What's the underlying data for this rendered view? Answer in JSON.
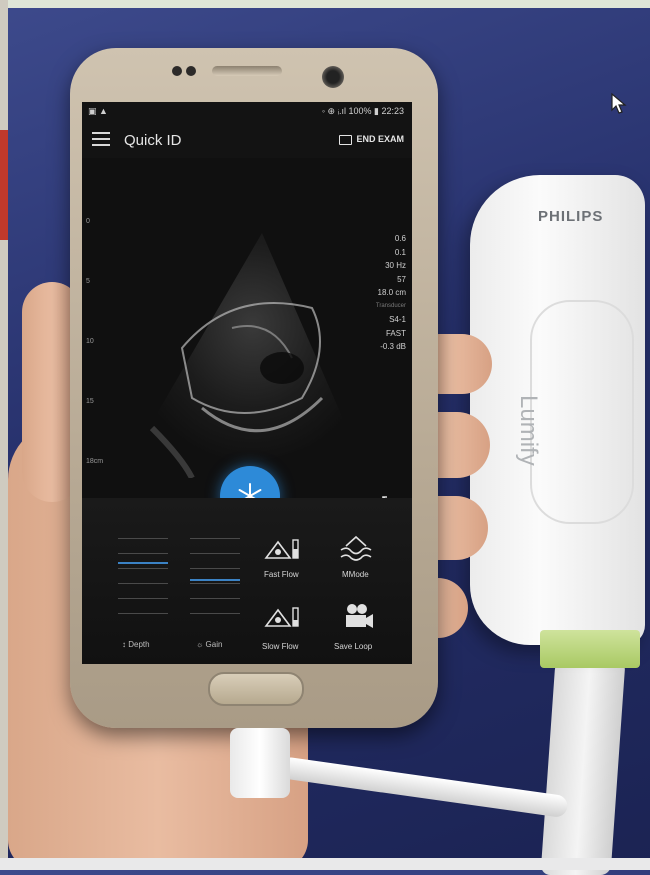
{
  "status_bar": {
    "left": "▣ ▲",
    "right": "◦ ⊕ ᵢ.ıl 100% ▮ 22:23"
  },
  "app_bar": {
    "title": "Quick ID",
    "end_exam_label": "END EXAM",
    "menu_icon": "hamburger-menu-icon"
  },
  "depth_scale": {
    "ticks": [
      "0",
      "5",
      "10",
      "15",
      "18cm"
    ]
  },
  "params": [
    {
      "label": "",
      "value": "0.6"
    },
    {
      "label": "",
      "value": "0.1"
    },
    {
      "label": "",
      "value": "30 Hz"
    },
    {
      "label": "",
      "value": "57"
    },
    {
      "label": "",
      "value": "18.0 cm"
    },
    {
      "label": "Transducer",
      "value": "S4-1"
    },
    {
      "label": "",
      "value": "FAST"
    },
    {
      "label": "",
      "value": "-0.3 dB"
    }
  ],
  "controls": {
    "depth_label": "↕ Depth",
    "gain_label": "☼ Gain",
    "fast_flow_label": "Fast Flow",
    "mmode_label": "MMode",
    "slow_flow_label": "Slow Flow",
    "save_loop_label": "Save Loop",
    "depth_level": 0.6,
    "gain_level": 0.4
  },
  "probe": {
    "brand": "PHILIPS",
    "model": "Lumify"
  },
  "colors": {
    "accent": "#2d8ad8",
    "screen_bg": "#131313",
    "slider_active": "#3b82c4"
  }
}
